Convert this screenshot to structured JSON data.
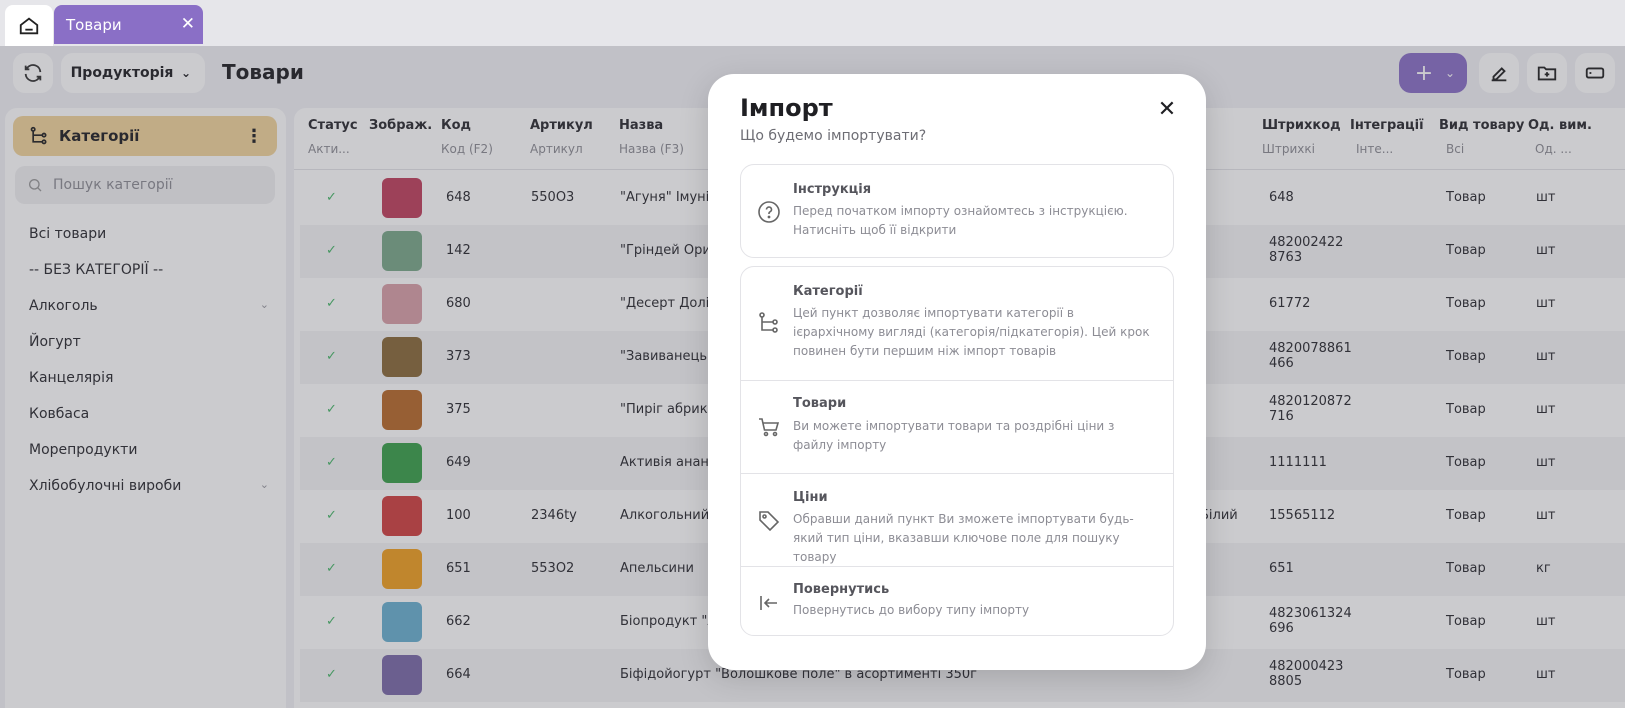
{
  "browser_tabs": {
    "active_label": "Товари"
  },
  "toolbar": {
    "module_dropdown": "Продукторія",
    "page_title": "Товари"
  },
  "sidebar": {
    "header": "Категорії",
    "search_placeholder": "Пошук категорії",
    "items": [
      {
        "label": "Всі товари",
        "expandable": false
      },
      {
        "label": "-- БЕЗ КАТЕГОРІЇ --",
        "expandable": false
      },
      {
        "label": "Алкоголь",
        "expandable": true
      },
      {
        "label": "Йогурт",
        "expandable": false
      },
      {
        "label": "Канцелярія",
        "expandable": false
      },
      {
        "label": "Ковбаса",
        "expandable": false
      },
      {
        "label": "Морепродукти",
        "expandable": false
      },
      {
        "label": "Хлібобулочні вироби",
        "expandable": true
      }
    ]
  },
  "table": {
    "headers": {
      "status": "Статус",
      "image": "Зображ.",
      "code": "Код",
      "article": "Артикул",
      "name": "Назва",
      "barcode": "Штрихкод",
      "integrations": "Інтеграції",
      "type": "Вид товару",
      "unit": "Од. вим."
    },
    "filters": {
      "status": "Акти...",
      "code": "Код (F2)",
      "article": "Артикул",
      "name": "Назва (F3)",
      "barcode": "Штрихкі",
      "integrations": "Інте...",
      "type": "Всі",
      "unit": "Од. ..."
    },
    "rows": [
      {
        "code": "648",
        "article": "550O3",
        "name": "\"Агуня\" Імуні",
        "extra": "",
        "barcode": "648",
        "barcode2": "",
        "type": "Товар",
        "unit": "шт",
        "thumb": "#c0405e"
      },
      {
        "code": "142",
        "article": "",
        "name": "\"Гріндей Ори",
        "extra": "",
        "barcode": "482002422",
        "barcode2": "8763",
        "type": "Товар",
        "unit": "шт",
        "thumb": "#7aa88a"
      },
      {
        "code": "680",
        "article": "",
        "name": "\"Десерт Долі",
        "extra": "",
        "barcode": "61772",
        "barcode2": "",
        "type": "Товар",
        "unit": "шт",
        "thumb": "#d8a0a8"
      },
      {
        "code": "373",
        "article": "",
        "name": "\"Завиванець",
        "extra": "",
        "barcode": "4820078861",
        "barcode2": "466",
        "type": "Товар",
        "unit": "шт",
        "thumb": "#8a6a3a"
      },
      {
        "code": "375",
        "article": "",
        "name": "\"Пиріг абрико",
        "extra": "",
        "barcode": "4820120872",
        "barcode2": "716",
        "type": "Товар",
        "unit": "шт",
        "thumb": "#b86a2a"
      },
      {
        "code": "649",
        "article": "",
        "name": "Активія анан",
        "extra": "",
        "barcode": "1111111",
        "barcode2": "",
        "type": "Товар",
        "unit": "шт",
        "thumb": "#3aa04a"
      },
      {
        "code": "100",
        "article": "2346ty",
        "name": "Алкогольний",
        "extra": "Білий",
        "barcode": "15565112",
        "barcode2": "",
        "type": "Товар",
        "unit": "шт",
        "thumb": "#d04040"
      },
      {
        "code": "651",
        "article": "553O2",
        "name": "Апельсини",
        "extra": "",
        "barcode": "651",
        "barcode2": "",
        "type": "Товар",
        "unit": "кг",
        "thumb": "#f0a020"
      },
      {
        "code": "662",
        "article": "",
        "name": "Біопродукт \"А",
        "extra": "",
        "barcode": "4823061324",
        "barcode2": "696",
        "type": "Товар",
        "unit": "шт",
        "thumb": "#6ab0d0"
      },
      {
        "code": "664",
        "article": "",
        "name": "Біфідойогурт \"Волошкове поле\" в асортименті 350г",
        "extra": "",
        "barcode": "482000423",
        "barcode2": "8805",
        "type": "Товар",
        "unit": "шт",
        "thumb": "#7a6aa8"
      }
    ]
  },
  "modal": {
    "title": "Імпорт",
    "subtitle": "Що будемо імпортувати?",
    "options": [
      {
        "icon": "help-circle-icon",
        "title": "Інструкція",
        "desc": "Перед початком імпорту ознайомтесь з інструкцією. Натисніть щоб її відкрити"
      },
      {
        "icon": "category-tree-icon",
        "title": "Категорії",
        "desc": "Цей пункт дозволяє імпортувати категорії в ієрархічному вигляді (категорія/підкатегорія). Цей крок повинен бути першим ніж імпорт товарів"
      },
      {
        "icon": "cart-icon",
        "title": "Товари",
        "desc": "Ви можете імпортувати товари та роздрібні ціни з файлу імпорту"
      },
      {
        "icon": "price-tag-icon",
        "title": "Ціни",
        "desc": "Обравши даний пункт Ви зможете імпортувати будь-який тип ціни, вказавши ключове поле для пошуку товару"
      },
      {
        "icon": "arrow-back-icon",
        "title": "Повернутись",
        "desc": "Повернутись до вибору типу імпорту"
      }
    ]
  },
  "colors": {
    "accent": "#8a6fc6",
    "category_header": "#f2d59b",
    "status_ok": "#49b86a"
  }
}
